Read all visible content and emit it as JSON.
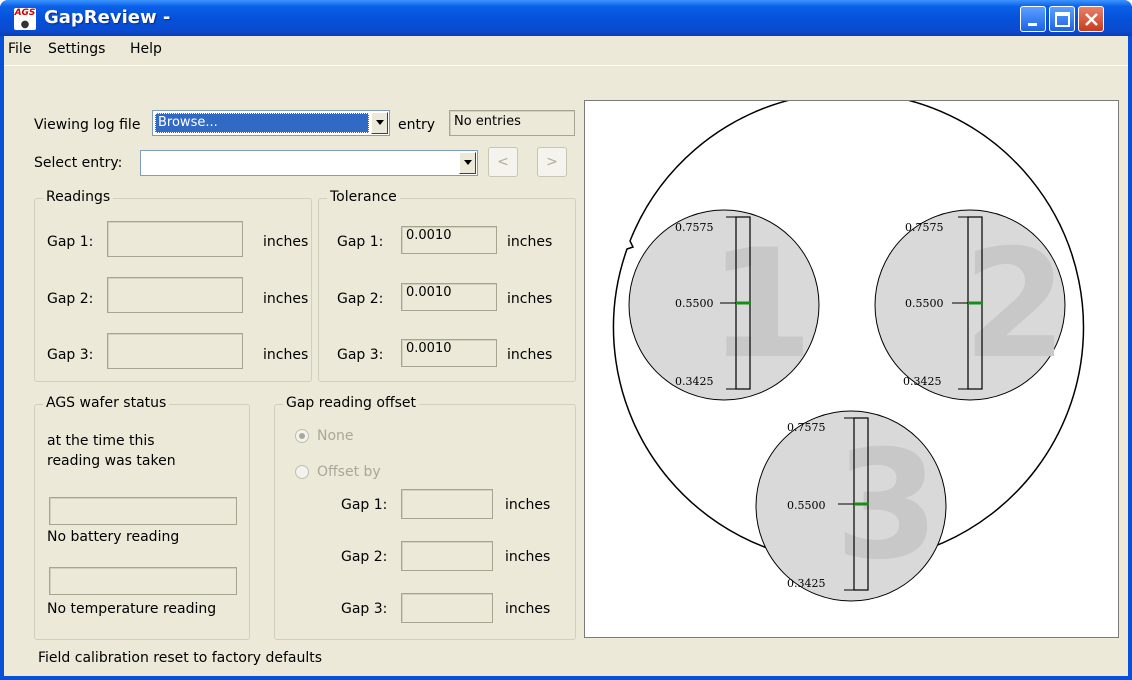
{
  "window": {
    "title": "GapReview -"
  },
  "menu": {
    "file": "File",
    "settings": "Settings",
    "help": "Help"
  },
  "viewing": {
    "label": "Viewing log file",
    "selected": "Browse...",
    "entry_label": "entry",
    "entry_value": "No entries"
  },
  "select_entry": {
    "label": "Select entry:",
    "value": "",
    "prev": "<",
    "next": ">"
  },
  "readings": {
    "title": "Readings",
    "gap1_label": "Gap 1:",
    "gap2_label": "Gap 2:",
    "gap3_label": "Gap 3:",
    "gap1_value": "",
    "gap2_value": "",
    "gap3_value": "",
    "unit": "inches"
  },
  "tolerance": {
    "title": "Tolerance",
    "gap1_label": "Gap 1:",
    "gap2_label": "Gap 2:",
    "gap3_label": "Gap 3:",
    "gap1_value": "0.0010",
    "gap2_value": "0.0010",
    "gap3_value": "0.0010",
    "unit": "inches"
  },
  "wafer_status": {
    "title": "AGS wafer status",
    "line1": "at the time this",
    "line2": "reading was taken",
    "battery": "No battery reading",
    "temperature": "No temperature reading"
  },
  "offset": {
    "title": "Gap reading offset",
    "none_label": "None",
    "offset_by_label": "Offset by",
    "gap1_label": "Gap 1:",
    "gap2_label": "Gap 2:",
    "gap3_label": "Gap 3:",
    "unit": "inches"
  },
  "status": {
    "text": "Field calibration reset to factory defaults"
  },
  "gauges": {
    "max": "0.7575",
    "mid": "0.5500",
    "min": "0.3425",
    "sensor1": "1",
    "sensor2": "2",
    "sensor3": "3"
  },
  "colors": {
    "marker": "#1a8a1a",
    "circle_fill": "#d9d9d9"
  }
}
